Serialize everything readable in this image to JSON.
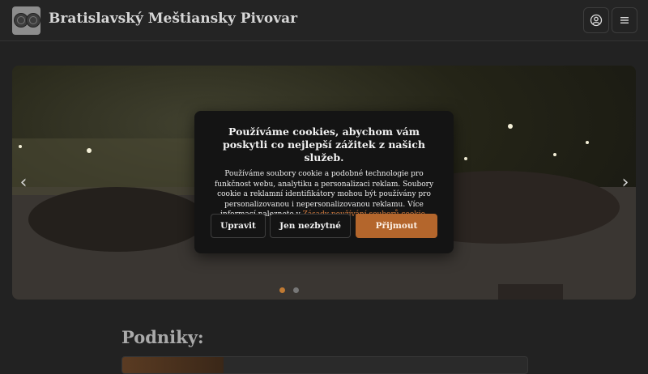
{
  "header": {
    "brand": "Bratislavský Meštiansky Pivovar",
    "logo_icon": "brewery-coins-logo",
    "account_icon": "user-circle-icon",
    "menu_icon": "hamburger-menu-icon"
  },
  "carousel": {
    "prev_icon": "chevron-left-icon",
    "next_icon": "chevron-right-icon",
    "slides": 2,
    "active_slide": 1,
    "image_description_icon": "beer-garden-photo"
  },
  "cookie_banner": {
    "title": "Používáme cookies, abychom vám poskytli co nejlepší zážitek z našich služeb.",
    "body": "Používáme soubory cookie a podobné technologie pro funkčnost webu, analytiku a personalizaci reklam. Soubory cookie a reklamní identifikátory mohou být používány pro personalizovanou i nepersonalizovanou reklamu. Více informací naleznete v",
    "link": "Zásady používání souborů cookie",
    "link_suffix": ".",
    "buttons": {
      "customize": "Upravit",
      "essential": "Jen nezbytné",
      "accept": "Přijmout"
    },
    "accent_color": "#b4662c"
  },
  "main": {
    "section_title": "Podniky:"
  }
}
